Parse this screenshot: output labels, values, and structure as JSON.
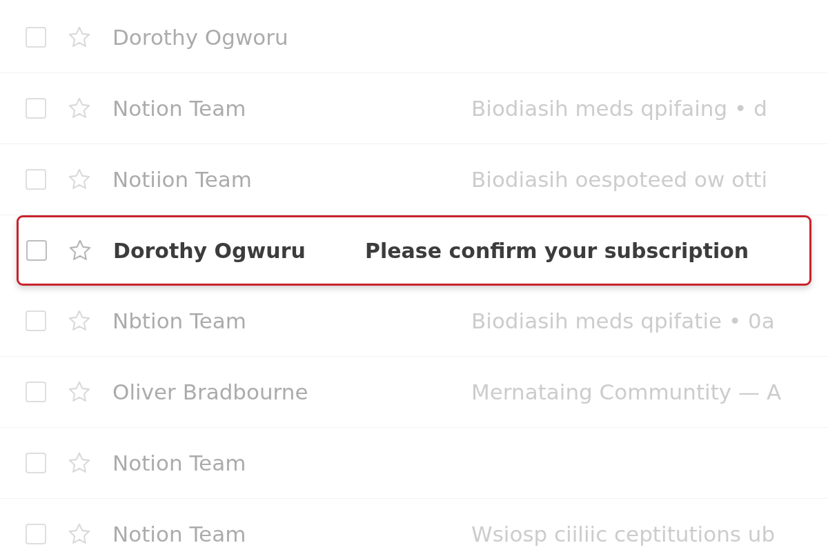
{
  "rows": [
    {
      "sender": "Dorothy Ogworu",
      "checked": false,
      "starred": false,
      "highlighted": false
    },
    {
      "sender": "Notion Team",
      "subject": "Biodiasih meds qpifaing • d",
      "checked": false,
      "starred": false,
      "highlighted": false
    },
    {
      "sender": "Notiion Team",
      "subject": "Biodiasih oespoteed ow otti",
      "checked": false,
      "starred": false,
      "highlighted": false
    },
    {
      "sender": "Dorothy Ogwuru",
      "subject": "Please confirm your subscription",
      "checked": false,
      "starred": false,
      "highlighted": true
    },
    {
      "sender": "Nbtion Team",
      "subject": "Biodiasih meds qpifatie • 0a",
      "checked": false,
      "starred": false,
      "highlighted": false
    },
    {
      "sender": "Oliver Bradbourne",
      "subject": "Mernataing Communtity — A",
      "checked": false,
      "starred": false,
      "highlighted": false
    },
    {
      "sender": "Notion Team",
      "checked": false,
      "starred": false,
      "highlighted": false
    },
    {
      "sender": "Notion Team",
      "subject": "Wsiosp ciiliic ceptitutions ub",
      "checked": false,
      "starred": false,
      "highlighted": false
    }
  ]
}
